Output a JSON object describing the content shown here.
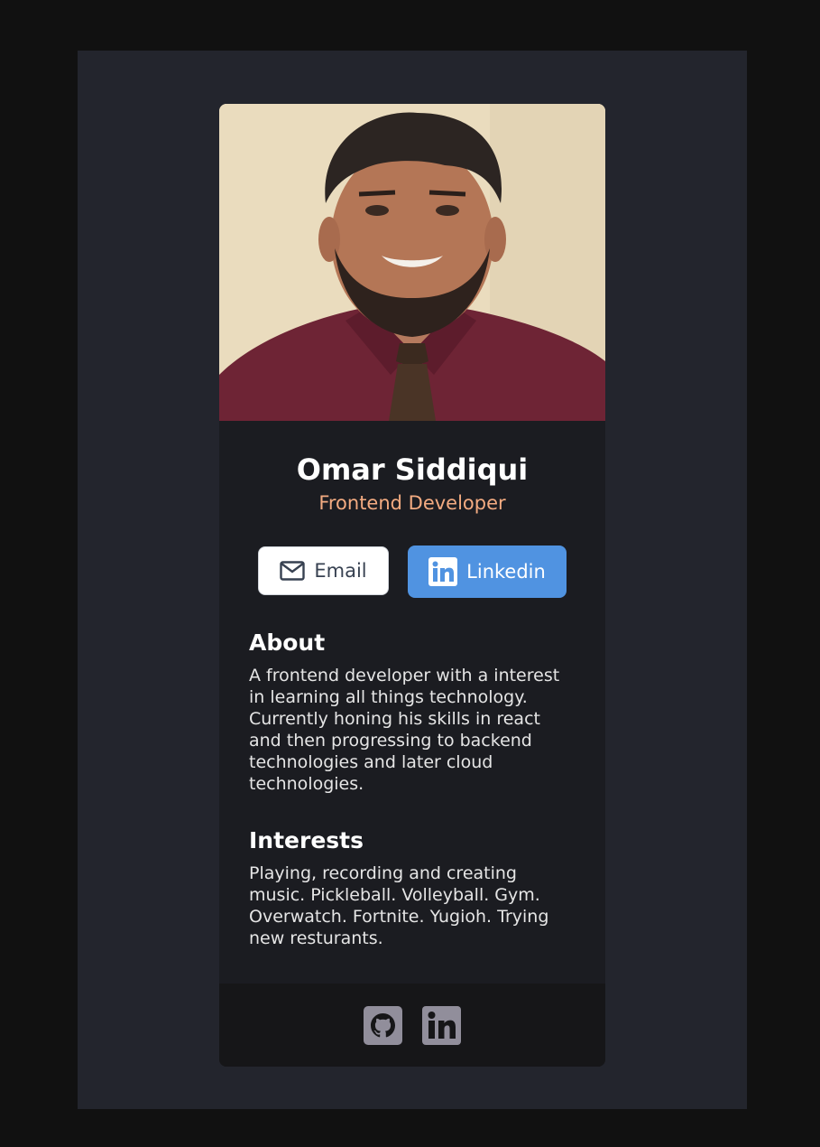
{
  "profile": {
    "name": "Omar Siddiqui",
    "role": "Frontend Developer"
  },
  "buttons": {
    "email_label": "Email",
    "linkedin_label": "Linkedin"
  },
  "about": {
    "heading": "About",
    "text": "A frontend developer with a interest in learning all things technology. Currently honing his skills in react and then progressing to backend technologies and later cloud technologies."
  },
  "interests": {
    "heading": "Interests",
    "text": "Playing, recording and creating music. Pickleball. Volleyball. Gym. Overwatch. Fortnite. Yugioh. Trying new resturants."
  },
  "footer": {
    "icons": [
      "github-icon",
      "linkedin-icon"
    ]
  },
  "colors": {
    "page_background": "#111111",
    "frame_background": "#23252d",
    "card_background": "#1b1c21",
    "footer_background": "#161618",
    "role_accent": "#f3ab81",
    "linkedin_blue": "#5093e1",
    "footer_icon": "#918e9b"
  }
}
